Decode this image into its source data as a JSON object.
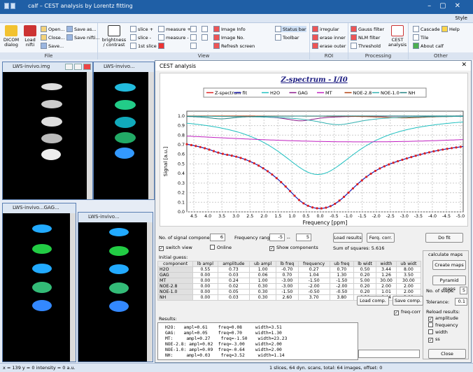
{
  "window": {
    "title": "calf – CEST analysis by Lorentz fitting",
    "style_label": "Style"
  },
  "ribbon": {
    "file": {
      "caption": "File",
      "dicom": "DICOM dialog",
      "load_nifti": "Load nifti",
      "open": "Open...",
      "close": "Close...",
      "save": "Save...",
      "save_as": "Save as...",
      "save_nifti": "Save nifti..."
    },
    "view": {
      "caption": "View",
      "brightness": "brightness / contrast",
      "slice_plus": "slice +",
      "slice_minus": "slice -",
      "first_slice": "1st slice",
      "measure_plus": "measure +",
      "measure_minus": "measure -",
      "image_info": "Image Info",
      "image_no": "Image No.",
      "refresh": "Refresh screen",
      "status_bar": "Status bar",
      "toolbar": "Toolbar"
    },
    "roi": {
      "caption": "ROI",
      "irregular": "irregular",
      "erase_inner": "erase inner",
      "erase_outer": "erase outer"
    },
    "processing": {
      "caption": "Processing",
      "gauss": "Gauss filter",
      "nlm": "NLM filter",
      "threshold": "Threshold",
      "cest": "CEST analysis"
    },
    "other": {
      "caption": "Other",
      "cascade": "Cascade",
      "tile": "Tile",
      "about": "About calf",
      "help": "Help"
    }
  },
  "image_windows": [
    {
      "title": "LWS-invivo.img"
    },
    {
      "title": "LWS-invivo..."
    },
    {
      "title": "LWS-invivo...GAG..."
    },
    {
      "title": "LWS-invivo..."
    }
  ],
  "dialog": {
    "title": "CEST analysis",
    "no_components_label": "No. of signal components:",
    "no_components": "6",
    "freq_range_label": "Frequency range:",
    "freq_min": "-5",
    "freq_sep": "--",
    "freq_max": "5",
    "load_results": "Load results",
    "ferq_corr": "Ferq. corr.",
    "do_fit": "Do fit",
    "switch_view": "switch view",
    "online": "Online",
    "show_components": "Show components",
    "sum_of_squares": "Sum of squares: 5.616",
    "initial_guess": "Initial guess:",
    "load_comp": "Load comp.",
    "save_comp": "Save comp.",
    "freq_corr": "freq-corr",
    "results_label": "Results:",
    "close": "Close",
    "calc_maps": "calculate maps",
    "create_maps": "Create maps",
    "pyramid_maps": "Pyramid maps",
    "no_steps_label": "No. of steps:",
    "no_steps": "5",
    "tolerance_label": "Tolerance:",
    "tolerance": "0.1",
    "reload_results": "Reload results:",
    "reload_opts": [
      "amplitude",
      "frequency",
      "width",
      "ss"
    ],
    "reload_checked": [
      true,
      false,
      false,
      true
    ]
  },
  "table": {
    "headers": [
      "component",
      "lb ampl",
      "amplitude",
      "ub ampl",
      "lb freq",
      "frequency",
      "ub freq",
      "lb widt",
      "width",
      "ub widt"
    ],
    "rows": [
      [
        "H2O",
        "0.55",
        "0.73",
        "1.00",
        "-0.70",
        "0.27",
        "0.70",
        "0.50",
        "3.44",
        "8.00"
      ],
      [
        "GAG",
        "0.00",
        "0.03",
        "0.06",
        "0.70",
        "1.04",
        "1.30",
        "0.20",
        "1.26",
        "3.50"
      ],
      [
        "MT",
        "0.00",
        "0.24",
        "1.00",
        "-3.00",
        "-1.50",
        "-1.50",
        "5.00",
        "30.00",
        "30.00"
      ],
      [
        "NOE-2.8",
        "0.00",
        "0.02",
        "0.30",
        "-3.00",
        "-2.00",
        "-2.00",
        "0.20",
        "2.00",
        "2.00"
      ],
      [
        "NOE-1.0",
        "0.00",
        "0.05",
        "0.30",
        "-1.50",
        "-0.50",
        "-0.50",
        "0.20",
        "1.01",
        "2.00"
      ],
      [
        "NH",
        "0.00",
        "0.03",
        "0.30",
        "2.60",
        "3.70",
        "3.80",
        "0.20",
        "0.44",
        "2.00"
      ]
    ]
  },
  "results": [
    "H2O:   ampl=0.61    freq=0.08     width=3.51",
    "GAG:   ampl=0.05    freq=0.70     width=1.30",
    "MT:     ampl=0.27    freq=-1.50    width=23.23",
    "NOE-2.8: ampl=0.02  freq=-3.00    width=2.00",
    "NOE-1.0: ampl=0.09  freq=-0.64    width=2.00",
    "NH:     ampl=0.03    freq=3.52     width=1.14"
  ],
  "status": {
    "left": "x = 139  y = 0  intensity = 0 a.u.",
    "right": "1 slices, 64 dyn. scans,   total: 64 images, offset: 0"
  },
  "chart_data": {
    "type": "line",
    "title": "Z-spectrum  -  I/I0",
    "xlabel": "Frequency [ppm]",
    "ylabel": "Signal [a.u.]",
    "xlim": [
      4.75,
      -5.1
    ],
    "ylim": [
      0,
      1.05
    ],
    "x_ticks": [
      4.5,
      4,
      3.5,
      3,
      2.5,
      2,
      1.5,
      1,
      0.5,
      0,
      -0.5,
      -1,
      -1.5,
      -2,
      -2.5,
      -3,
      -3.5,
      -4,
      -4.5,
      -5
    ],
    "y_ticks": [
      0,
      0.1,
      0.2,
      0.3,
      0.4,
      0.5,
      0.6,
      0.7,
      0.8,
      0.9,
      1.0
    ],
    "legend": [
      "Z-spectrum",
      "fit",
      "H2O",
      "GAG",
      "MT",
      "NOE-2.8",
      "NOE-1.0",
      "NH"
    ],
    "colors": {
      "Z-spectrum": "#e02020",
      "fit": "#1a1ab0",
      "H2O": "#20c0c0",
      "GAG": "#8a1a8a",
      "MT": "#c020c0",
      "NOE-2.8": "#b04010",
      "NOE-1.0": "#30b0b0",
      "NH": "#208080"
    },
    "components": [
      {
        "name": "H2O",
        "ampl": 0.61,
        "freq": 0.08,
        "width": 3.51
      },
      {
        "name": "GAG",
        "ampl": 0.05,
        "freq": 0.7,
        "width": 1.3
      },
      {
        "name": "MT",
        "ampl": 0.27,
        "freq": -1.5,
        "width": 23.23
      },
      {
        "name": "NOE-2.8",
        "ampl": 0.02,
        "freq": -3.0,
        "width": 2.0
      },
      {
        "name": "NOE-1.0",
        "ampl": 0.09,
        "freq": -0.64,
        "width": 2.0
      },
      {
        "name": "NH",
        "ampl": 0.03,
        "freq": 3.52,
        "width": 1.14
      }
    ]
  }
}
